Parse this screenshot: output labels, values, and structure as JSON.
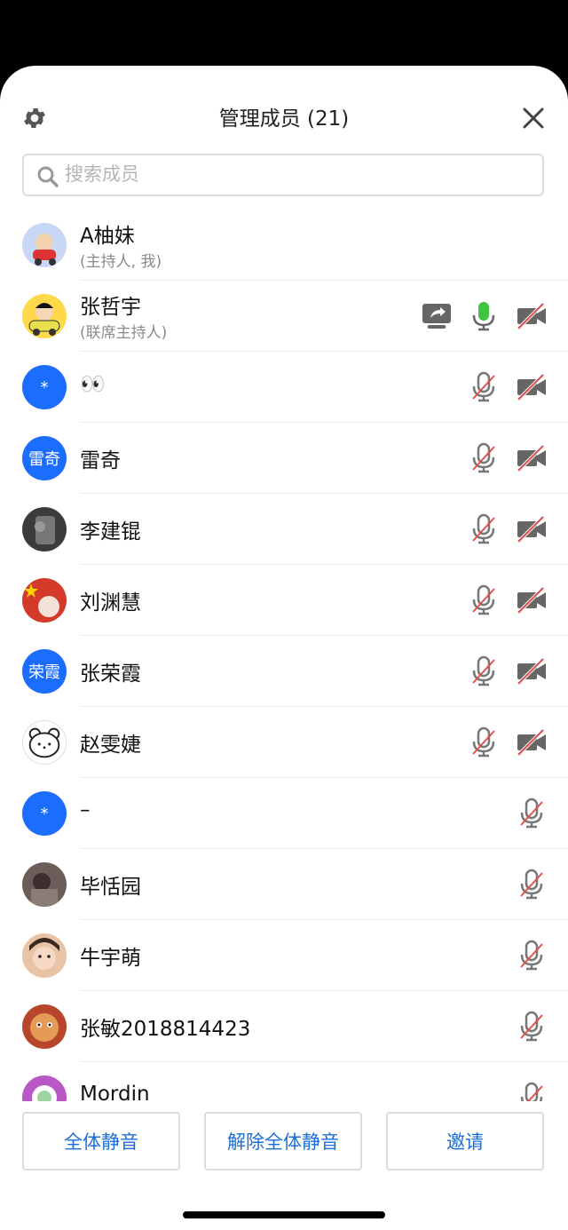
{
  "header": {
    "title": "管理成员 (21)"
  },
  "search": {
    "placeholder": "搜索成员"
  },
  "members": [
    {
      "name": "A柚妹",
      "role": "(主持人, 我)"
    },
    {
      "name": "张哲宇",
      "role": "(联席主持人)"
    },
    {
      "name": "👀",
      "avatar_text": "*"
    },
    {
      "name": "雷奇",
      "avatar_text": "雷奇"
    },
    {
      "name": "李建锟"
    },
    {
      "name": "刘渊慧"
    },
    {
      "name": "张荣霞",
      "avatar_text": "荣霞"
    },
    {
      "name": "赵雯婕"
    },
    {
      "name": "–",
      "avatar_text": "*"
    },
    {
      "name": "毕恬园"
    },
    {
      "name": "牛宇萌"
    },
    {
      "name": "张敏2018814423"
    },
    {
      "name": "Mordin"
    }
  ],
  "footer": {
    "mute_all": "全体静音",
    "unmute_all": "解除全体静音",
    "invite": "邀请"
  },
  "colors": {
    "accent": "#1a6ddb",
    "avatar_blue": "#1b6dff",
    "mic_active": "#3ec43e",
    "muted_slash": "#e05050"
  }
}
